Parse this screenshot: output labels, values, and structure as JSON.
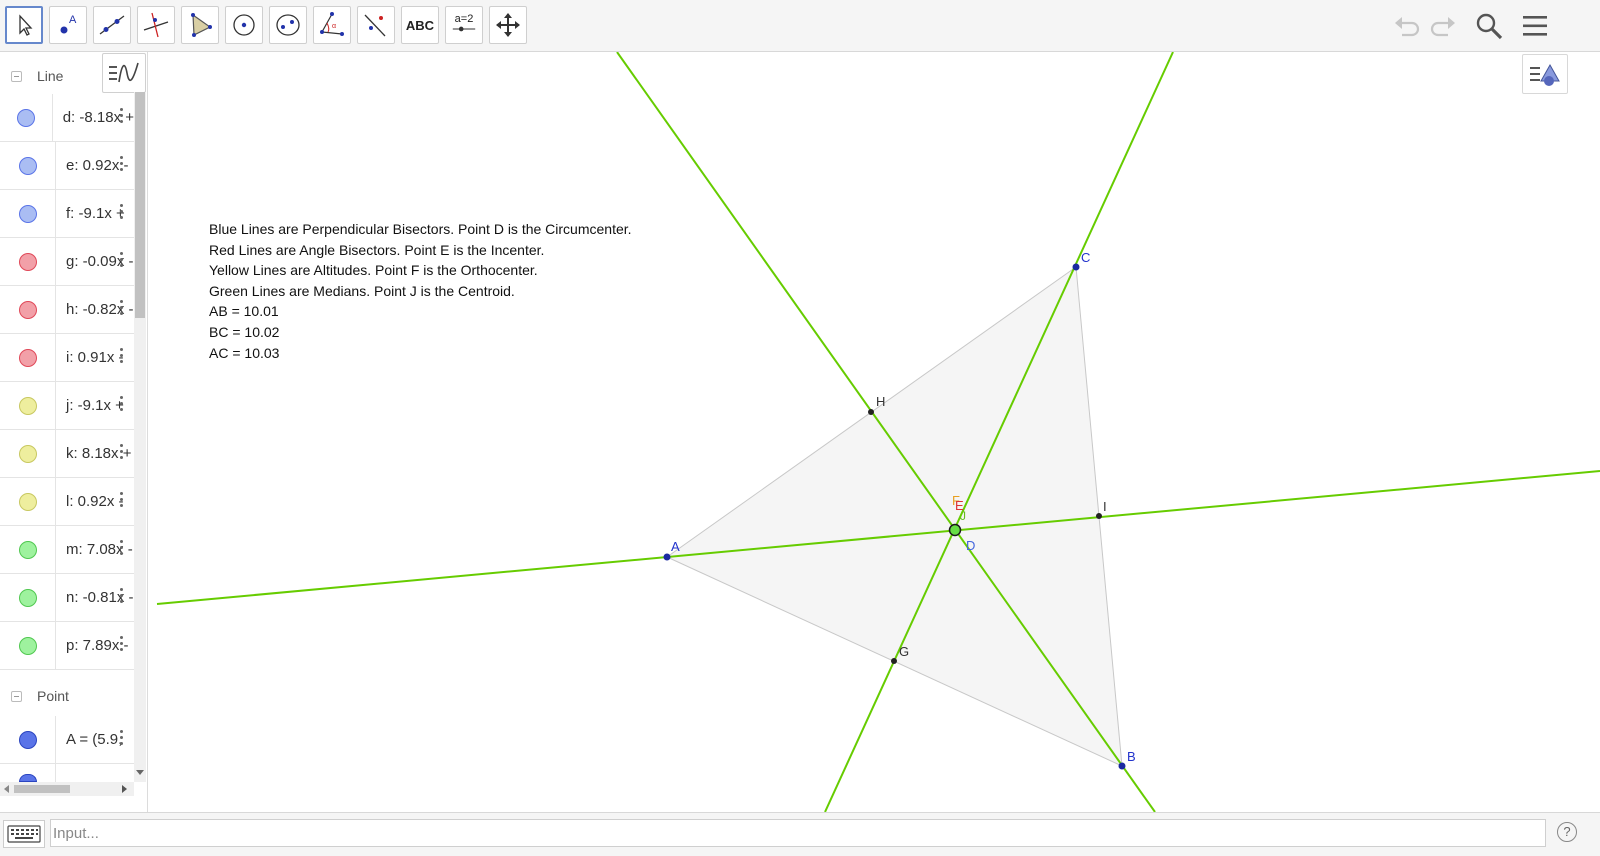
{
  "toolbar": {
    "tools": [
      {
        "name": "move-tool"
      },
      {
        "name": "point-tool",
        "label": "A"
      },
      {
        "name": "line-tool"
      },
      {
        "name": "perpendicular-line-tool"
      },
      {
        "name": "polygon-tool"
      },
      {
        "name": "circle-center-point-tool"
      },
      {
        "name": "ellipse-tool"
      },
      {
        "name": "angle-tool"
      },
      {
        "name": "reflect-tool"
      },
      {
        "name": "text-tool",
        "label": "ABC"
      },
      {
        "name": "slider-tool",
        "label": "a=2"
      },
      {
        "name": "move-graphics-view-tool"
      }
    ]
  },
  "algebra": {
    "groups": [
      {
        "title": "Line",
        "items": [
          {
            "def": "d: -8.18x + ",
            "color": "#7a9cf0"
          },
          {
            "def": "e: 0.92x - ",
            "color": "#7a9cf0"
          },
          {
            "def": "f: -9.1x + ",
            "color": "#7a9cf0"
          },
          {
            "def": "g: -0.09x - ",
            "color": "#f07a8a"
          },
          {
            "def": "h: -0.82x - ",
            "color": "#f07a8a"
          },
          {
            "def": "i: 0.91x - ",
            "color": "#f07a8a"
          },
          {
            "def": "j: -9.1x + ",
            "color": "#e8e87a"
          },
          {
            "def": "k: 8.18x + ",
            "color": "#e8e87a"
          },
          {
            "def": "l: 0.92x - ",
            "color": "#e8e87a"
          },
          {
            "def": "m: 7.08x - ",
            "color": "#7af07a"
          },
          {
            "def": "n: -0.81x - ",
            "color": "#7af07a"
          },
          {
            "def": "p: 7.89x - ",
            "color": "#7af07a"
          }
        ]
      },
      {
        "title": "Point",
        "items": [
          {
            "def": "A = (5.9, ",
            "color": "#5a74e8"
          }
        ]
      }
    ]
  },
  "canvas": {
    "text_lines": [
      "Blue Lines are Perpendicular Bisectors. Point D is the Circumcenter.",
      "Red Lines are Angle Bisectors. Point E is the Incenter.",
      "Yellow Lines are Altitudes. Point F is the Orthocenter.",
      "Green Lines are Medians. Point J is the Centroid.",
      "AB = 10.01",
      "BC = 10.02",
      "AC = 10.03"
    ],
    "point_labels": {
      "A": "A",
      "B": "B",
      "C": "C",
      "D": "D",
      "E": "E",
      "F": "F",
      "G": "G",
      "H": "H",
      "I": "I",
      "J": "J"
    },
    "colors": {
      "line": "#66cc00",
      "triangle_fill": "#f4f4f4",
      "triangle_edge": "#c8c8c8",
      "vertex_label": "#1a1aa0",
      "midpoint": "#222222"
    }
  },
  "input": {
    "placeholder": "Input..."
  },
  "help_label": "?"
}
